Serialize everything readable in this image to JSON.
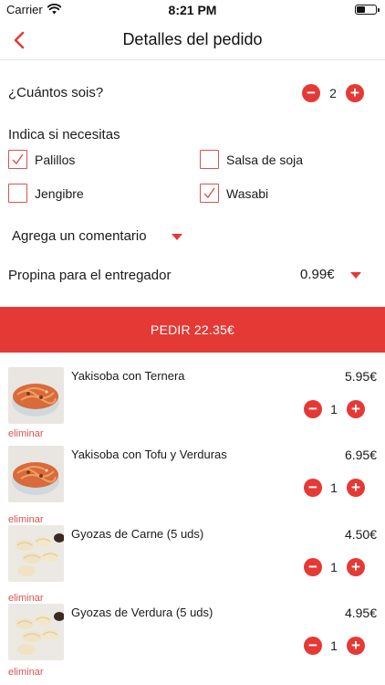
{
  "status_bar": {
    "carrier": "Carrier",
    "time": "8:21 PM"
  },
  "nav": {
    "title": "Detalles del pedido"
  },
  "people": {
    "label": "¿Cuántos sois?",
    "count": "2"
  },
  "extras": {
    "title": "Indica si necesitas",
    "options": [
      {
        "label": "Palillos",
        "checked": true
      },
      {
        "label": "Salsa de soja",
        "checked": false
      },
      {
        "label": "Jengibre",
        "checked": false
      },
      {
        "label": "Wasabi",
        "checked": true
      }
    ]
  },
  "comment": {
    "label": "Agrega un comentario"
  },
  "tip": {
    "label": "Propina para el entregador",
    "value": "0.99€"
  },
  "order_button": {
    "label": "PEDIR 22.35€"
  },
  "remove_label": "eliminar",
  "items": [
    {
      "name": "Yakisoba con Ternera",
      "price": "5.95€",
      "qty": "1",
      "image": "noodles"
    },
    {
      "name": "Yakisoba con Tofu y Verduras",
      "price": "6.95€",
      "qty": "1",
      "image": "noodles"
    },
    {
      "name": "Gyozas de Carne (5 uds)",
      "price": "4.50€",
      "qty": "1",
      "image": "dumplings"
    },
    {
      "name": "Gyozas de Verdura (5 uds)",
      "price": "4.95€",
      "qty": "1",
      "image": "dumplings"
    }
  ],
  "colors": {
    "accent": "#e53935",
    "text": "#1a1a1a",
    "divider": "#e6e6e6"
  },
  "icons": {
    "back": "chevron-left-icon",
    "wifi": "wifi-icon",
    "battery": "battery-icon",
    "dropdown": "caret-down-icon",
    "check": "check-icon"
  }
}
